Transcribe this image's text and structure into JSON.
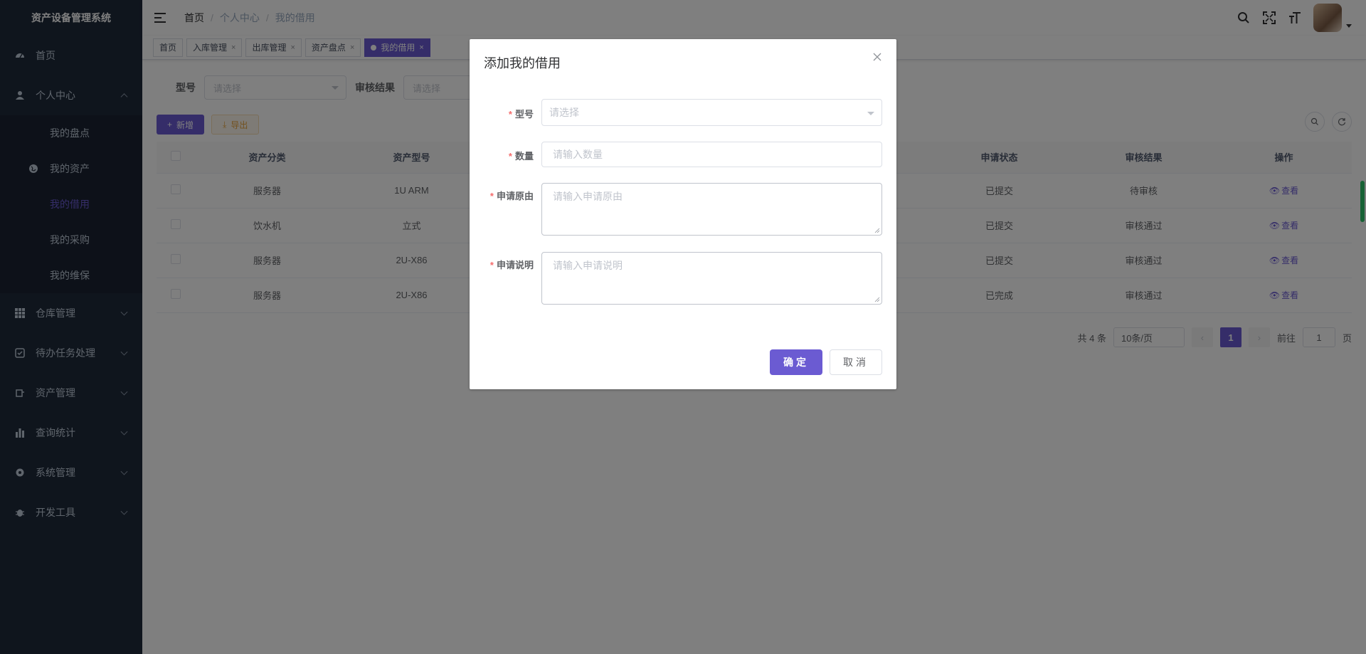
{
  "app": {
    "title": "资产设备管理系统"
  },
  "sidebar": {
    "items": [
      {
        "label": "首页",
        "icon": "dashboard-icon"
      },
      {
        "label": "个人中心",
        "icon": "user-icon",
        "expanded": true,
        "children": [
          {
            "label": "我的盘点"
          },
          {
            "label": "我的资产",
            "icon": "globe-icon"
          },
          {
            "label": "我的借用",
            "active": true
          },
          {
            "label": "我的采购"
          },
          {
            "label": "我的维保"
          }
        ]
      },
      {
        "label": "仓库管理",
        "icon": "grid-icon"
      },
      {
        "label": "待办任务处理",
        "icon": "checkbox-icon"
      },
      {
        "label": "资产管理",
        "icon": "asset-icon"
      },
      {
        "label": "查询统计",
        "icon": "bar-chart-icon"
      },
      {
        "label": "系统管理",
        "icon": "gear-icon"
      },
      {
        "label": "开发工具",
        "icon": "bug-icon"
      }
    ]
  },
  "header": {
    "breadcrumb": [
      "首页",
      "个人中心",
      "我的借用"
    ]
  },
  "tags": [
    "首页",
    "入库管理",
    "出库管理",
    "资产盘点",
    "我的借用"
  ],
  "search": {
    "model_label": "型号",
    "model_placeholder": "请选择",
    "result_label": "审核结果",
    "result_placeholder": "请选择"
  },
  "toolbar": {
    "add_label": "新增",
    "export_label": "导出"
  },
  "table": {
    "headers": [
      "资产分类",
      "资产型号",
      "申请状态",
      "审核结果",
      "操作"
    ],
    "rows": [
      {
        "category": "服务器",
        "model": "1U ARM",
        "status": "已提交",
        "result": "待审核",
        "action": "查看"
      },
      {
        "category": "饮水机",
        "model": "立式",
        "status": "已提交",
        "result": "审核通过",
        "action": "查看"
      },
      {
        "category": "服务器",
        "model": "2U-X86",
        "status": "已提交",
        "result": "审核通过",
        "action": "查看"
      },
      {
        "category": "服务器",
        "model": "2U-X86",
        "status": "已完成",
        "result": "审核通过",
        "action": "查看"
      }
    ]
  },
  "pagination": {
    "total": "共 4 条",
    "page_size": "10条/页",
    "current": "1",
    "goto_prefix": "前往",
    "goto_value": "1",
    "goto_suffix": "页"
  },
  "dialog": {
    "title": "添加我的借用",
    "fields": {
      "model": {
        "label": "型号",
        "placeholder": "请选择"
      },
      "quantity": {
        "label": "数量",
        "placeholder": "请输入数量"
      },
      "reason": {
        "label": "申请原由",
        "placeholder": "请输入申请原由"
      },
      "description": {
        "label": "申请说明",
        "placeholder": "请输入申请说明"
      }
    },
    "confirm_label": "确定",
    "cancel_label": "取消"
  },
  "colors": {
    "primary": "#6b5bd2",
    "sidebar_bg": "#1f2a3b",
    "required": "#f56c6c"
  }
}
